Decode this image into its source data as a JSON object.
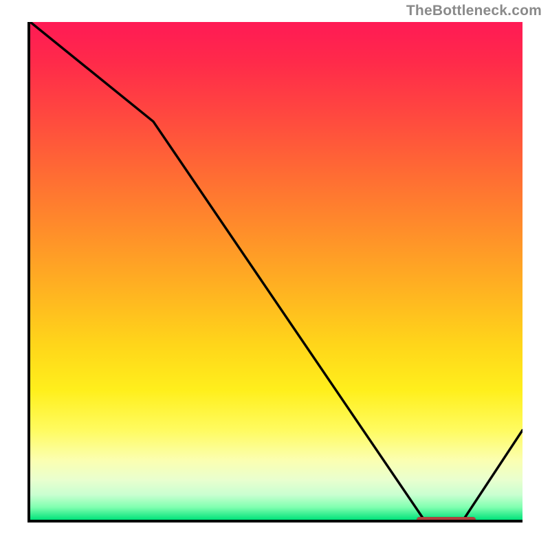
{
  "attribution": "TheBottleneck.com",
  "chart_data": {
    "type": "line",
    "title": "",
    "xlabel": "",
    "ylabel": "",
    "xlim": [
      0,
      100
    ],
    "ylim": [
      0,
      100
    ],
    "x": [
      0,
      25,
      80,
      88,
      100
    ],
    "values": [
      100,
      80,
      0,
      0,
      18
    ],
    "annotations": [
      {
        "kind": "marker",
        "x_start": 78,
        "x_end": 90,
        "y": 0
      }
    ],
    "gradient_stops": [
      {
        "pct": 0,
        "color": "#ff1a55"
      },
      {
        "pct": 30,
        "color": "#ff6a34"
      },
      {
        "pct": 65,
        "color": "#ffd61a"
      },
      {
        "pct": 88,
        "color": "#fbffb0"
      },
      {
        "pct": 100,
        "color": "#00e37a"
      }
    ]
  }
}
